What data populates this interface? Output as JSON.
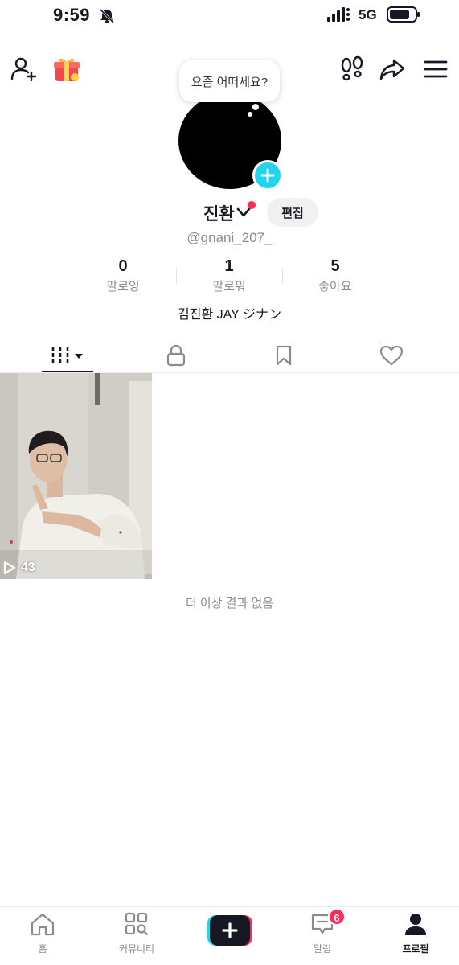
{
  "status_bar": {
    "time": "9:59",
    "network": "5G"
  },
  "profile": {
    "status_bubble": "요즘 어떠세요?",
    "display_name": "진환",
    "edit_label": "편집",
    "username": "@gnani_207_",
    "bio": "김진환 JAY ジナン",
    "stats": [
      {
        "value": "0",
        "label": "팔로잉"
      },
      {
        "value": "1",
        "label": "팔로워"
      },
      {
        "value": "5",
        "label": "좋아요"
      }
    ]
  },
  "videos": [
    {
      "views": "43"
    }
  ],
  "end_message": "더 이상 결과 없음",
  "bottom_nav": {
    "home": "홈",
    "community": "커뮤니티",
    "inbox": "알림",
    "inbox_badge": "6",
    "profile": "프로필"
  },
  "colors": {
    "accent_cyan": "#20d5ec",
    "accent_red": "#fe2c55",
    "muted_text": "#8a8b91"
  },
  "icons": [
    "bell-mute-icon",
    "signal-icon",
    "battery-icon",
    "add-friend-icon",
    "gift-icon",
    "footprint-icon",
    "share-icon",
    "menu-icon",
    "plus-icon",
    "chevron-down-icon",
    "grid-icon",
    "lock-icon",
    "bookmark-icon",
    "heart-icon",
    "play-icon",
    "home-icon",
    "community-icon",
    "inbox-icon",
    "profile-icon"
  ]
}
